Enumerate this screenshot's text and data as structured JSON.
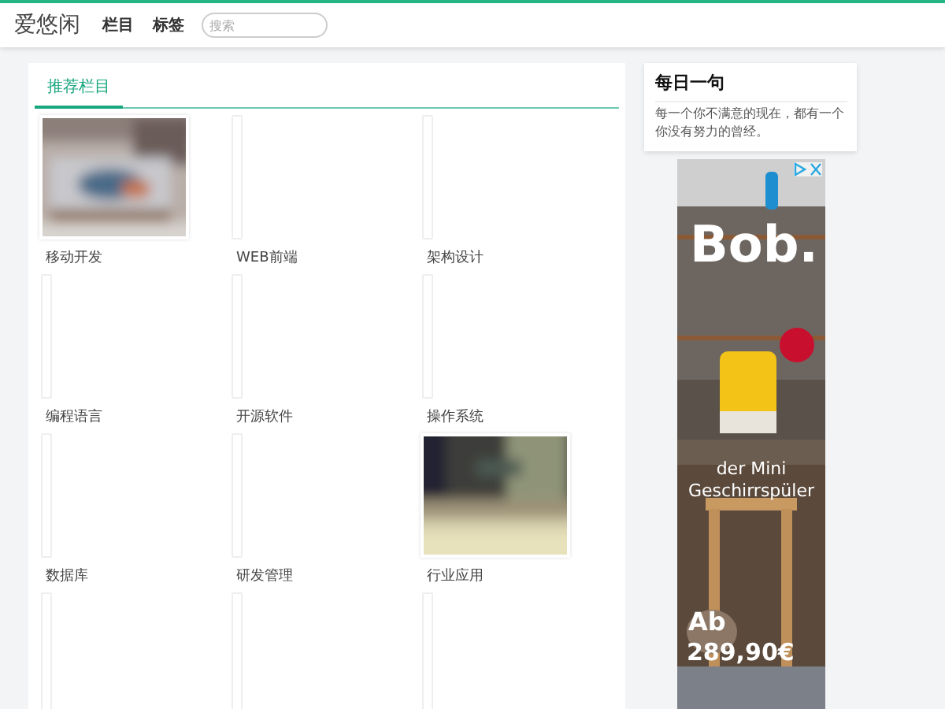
{
  "header": {
    "logo": "爱悠闲",
    "nav": [
      {
        "label": "栏目"
      },
      {
        "label": "标签"
      }
    ],
    "search": {
      "placeholder": "搜索"
    }
  },
  "main": {
    "tabs": [
      {
        "label": "推荐栏目",
        "selected": true
      }
    ],
    "items": [
      {
        "label": "移动开发",
        "kind": "picture"
      },
      {
        "label": "WEB前端",
        "kind": "broken"
      },
      {
        "label": "架构设计",
        "kind": "broken"
      },
      {
        "label": "编程语言",
        "kind": "broken"
      },
      {
        "label": "开源软件",
        "kind": "broken"
      },
      {
        "label": "操作系统",
        "kind": "broken"
      },
      {
        "label": "数据库",
        "kind": "broken"
      },
      {
        "label": "研发管理",
        "kind": "broken"
      },
      {
        "label": "行业应用",
        "kind": "picture"
      },
      {
        "kind": "broken"
      },
      {
        "kind": "broken"
      },
      {
        "kind": "broken"
      }
    ]
  },
  "quote": {
    "title": "每日一句",
    "text": "每一个你不满意的现在，都有一个你没有努力的曾经。"
  },
  "ad": {
    "logo": "Bob.",
    "headline": "der Mini Geschirrspüler",
    "price_prefix": "Ab",
    "price": "289,90€"
  }
}
